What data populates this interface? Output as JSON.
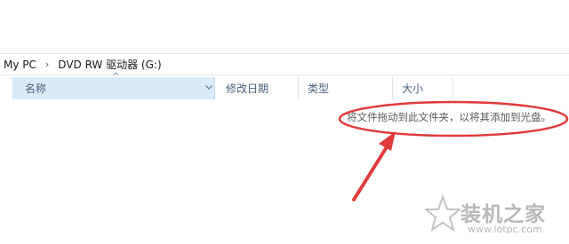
{
  "breadcrumb": {
    "items": [
      "My PC",
      "DVD RW 驱动器 (G:)"
    ],
    "separator": "›"
  },
  "columns": {
    "name": "名称",
    "date_modified": "修改日期",
    "type": "类型",
    "size": "大小"
  },
  "empty_folder_hint": "将文件拖动到此文件夹，以将其添加到光盘。",
  "annotation": {
    "color": "#e03a3a"
  },
  "watermark": {
    "title": "装机之家",
    "url": "www.lotpc.com"
  }
}
